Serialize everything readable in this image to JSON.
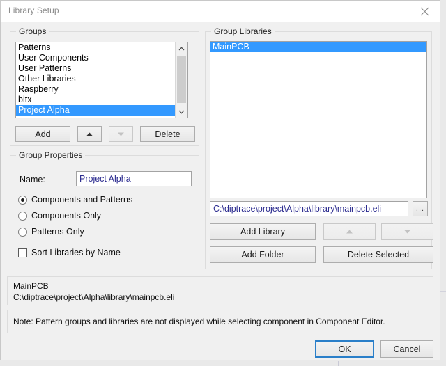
{
  "window": {
    "title": "Library Setup",
    "close_icon": "close-icon"
  },
  "groups_panel": {
    "legend": "Groups",
    "items": [
      {
        "label": "Patterns",
        "selected": false
      },
      {
        "label": "User Components",
        "selected": false
      },
      {
        "label": "User Patterns",
        "selected": false
      },
      {
        "label": "Other Libraries",
        "selected": false
      },
      {
        "label": "Raspberry",
        "selected": false
      },
      {
        "label": "bitx",
        "selected": false
      },
      {
        "label": "Project Alpha",
        "selected": true
      }
    ],
    "buttons": {
      "add": "Add",
      "move_up_icon": "arrow-up-icon",
      "move_down_icon": "arrow-down-icon",
      "delete": "Delete"
    }
  },
  "group_properties": {
    "legend": "Group Properties",
    "name_label": "Name:",
    "name_value": "Project Alpha",
    "options": [
      {
        "label": "Components and Patterns",
        "selected": true
      },
      {
        "label": "Components Only",
        "selected": false
      },
      {
        "label": "Patterns Only",
        "selected": false
      }
    ],
    "sort_checkbox": {
      "label": "Sort Libraries by Name",
      "checked": false
    }
  },
  "group_libraries": {
    "legend": "Group Libraries",
    "items": [
      {
        "label": "MainPCB",
        "selected": true
      }
    ],
    "path_value": "C:\\diptrace\\project\\Alpha\\library\\mainpcb.eli",
    "browse_label": "...",
    "buttons": {
      "add_library": "Add Library",
      "move_up_icon": "arrow-up-icon",
      "move_down_icon": "arrow-down-icon",
      "add_folder": "Add Folder",
      "delete_selected": "Delete Selected"
    }
  },
  "info": {
    "line1": "MainPCB",
    "line2": "C:\\diptrace\\project\\Alpha\\library\\mainpcb.eli",
    "note": "Note: Pattern groups and libraries are not displayed while selecting component in Component Editor."
  },
  "footer": {
    "ok": "OK",
    "cancel": "Cancel"
  },
  "colors": {
    "selection": "#3399ff",
    "accent": "#2a7fc9",
    "path_text": "#2b2b8f"
  }
}
